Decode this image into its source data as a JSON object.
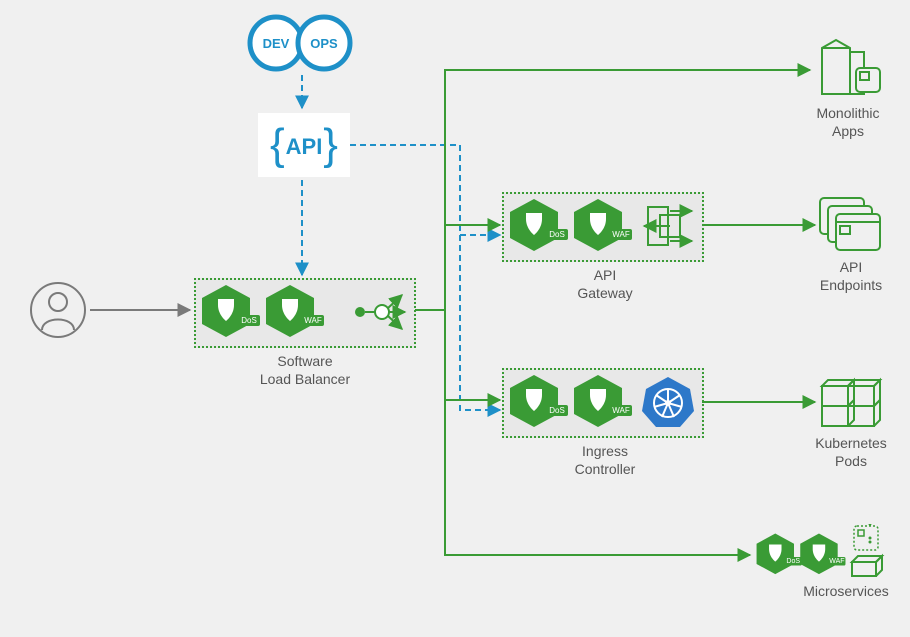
{
  "colors": {
    "blue": "#1e90c8",
    "green": "#3a9b35",
    "grey": "#7a7a7a",
    "darkGrey": "#555555"
  },
  "devops": {
    "dev": "DEV",
    "ops": "OPS"
  },
  "api": {
    "label": "API"
  },
  "user": {
    "label": "user-icon"
  },
  "loadBalancer": {
    "label_l1": "Software",
    "label_l2": "Load Balancer",
    "dos": "DoS",
    "waf": "WAF"
  },
  "apiGateway": {
    "label_l1": "API",
    "label_l2": "Gateway",
    "dos": "DoS",
    "waf": "WAF"
  },
  "ingress": {
    "label_l1": "Ingress",
    "label_l2": "Controller",
    "dos": "DoS",
    "waf": "WAF"
  },
  "targets": {
    "monolithic_l1": "Monolithic",
    "monolithic_l2": "Apps",
    "apiEndpoints_l1": "API",
    "apiEndpoints_l2": "Endpoints",
    "kubePods_l1": "Kubernetes",
    "kubePods_l2": "Pods",
    "microservices": "Microservices",
    "ms_dos": "DoS",
    "ms_waf": "WAF"
  }
}
